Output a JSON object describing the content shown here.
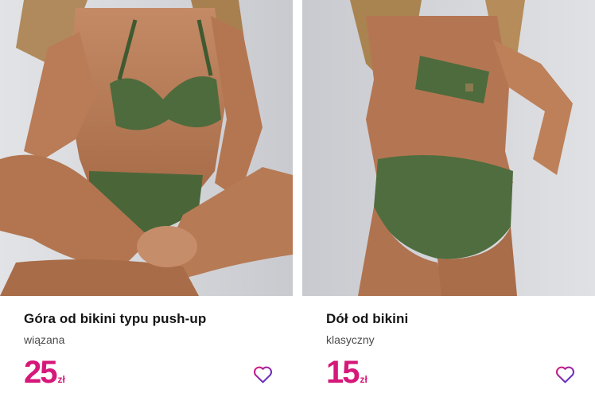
{
  "products": [
    {
      "title": "Góra od bikini typu push-up",
      "subtitle": "wiązana",
      "price": "25",
      "currency": "zł",
      "image_description_icon": "product-photo-bikini-top"
    },
    {
      "title": "Dół od bikini",
      "subtitle": "klasyczny",
      "price": "15",
      "currency": "zł",
      "image_description_icon": "product-photo-bikini-bottom"
    }
  ],
  "colors": {
    "price": "#d6187a",
    "heart_outline_from": "#e21a7a",
    "heart_outline_to": "#3b3fd8",
    "swimsuit": "#4d6b3c",
    "photo_background": "#d7d8dc"
  }
}
